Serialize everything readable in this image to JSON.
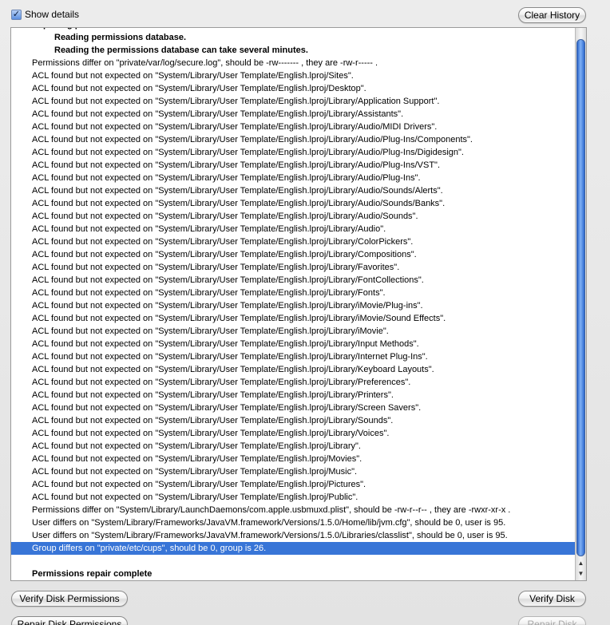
{
  "header": {
    "show_details_label": "Show details",
    "show_details_checked": "✓",
    "clear_history_label": "Clear History"
  },
  "log": {
    "lines": [
      {
        "text": "Repairing permissions for “Macintosh HD”",
        "style": "bold"
      },
      {
        "text": "Reading permissions database.",
        "style": "bold indent"
      },
      {
        "text": "Reading the permissions database can take several minutes.",
        "style": "bold indent"
      },
      {
        "text": "Permissions differ on \"private/var/log/secure.log\", should be -rw------- , they are -rw-r----- ."
      },
      {
        "text": "ACL found but not expected on \"System/Library/User Template/English.lproj/Sites\"."
      },
      {
        "text": "ACL found but not expected on \"System/Library/User Template/English.lproj/Desktop\"."
      },
      {
        "text": "ACL found but not expected on \"System/Library/User Template/English.lproj/Library/Application Support\"."
      },
      {
        "text": "ACL found but not expected on \"System/Library/User Template/English.lproj/Library/Assistants\"."
      },
      {
        "text": "ACL found but not expected on \"System/Library/User Template/English.lproj/Library/Audio/MIDI Drivers\"."
      },
      {
        "text": "ACL found but not expected on \"System/Library/User Template/English.lproj/Library/Audio/Plug-Ins/Components\"."
      },
      {
        "text": "ACL found but not expected on \"System/Library/User Template/English.lproj/Library/Audio/Plug-Ins/Digidesign\"."
      },
      {
        "text": "ACL found but not expected on \"System/Library/User Template/English.lproj/Library/Audio/Plug-Ins/VST\"."
      },
      {
        "text": "ACL found but not expected on \"System/Library/User Template/English.lproj/Library/Audio/Plug-Ins\"."
      },
      {
        "text": "ACL found but not expected on \"System/Library/User Template/English.lproj/Library/Audio/Sounds/Alerts\"."
      },
      {
        "text": "ACL found but not expected on \"System/Library/User Template/English.lproj/Library/Audio/Sounds/Banks\"."
      },
      {
        "text": "ACL found but not expected on \"System/Library/User Template/English.lproj/Library/Audio/Sounds\"."
      },
      {
        "text": "ACL found but not expected on \"System/Library/User Template/English.lproj/Library/Audio\"."
      },
      {
        "text": "ACL found but not expected on \"System/Library/User Template/English.lproj/Library/ColorPickers\"."
      },
      {
        "text": "ACL found but not expected on \"System/Library/User Template/English.lproj/Library/Compositions\"."
      },
      {
        "text": "ACL found but not expected on \"System/Library/User Template/English.lproj/Library/Favorites\"."
      },
      {
        "text": "ACL found but not expected on \"System/Library/User Template/English.lproj/Library/FontCollections\"."
      },
      {
        "text": "ACL found but not expected on \"System/Library/User Template/English.lproj/Library/Fonts\"."
      },
      {
        "text": "ACL found but not expected on \"System/Library/User Template/English.lproj/Library/iMovie/Plug-ins\"."
      },
      {
        "text": "ACL found but not expected on \"System/Library/User Template/English.lproj/Library/iMovie/Sound Effects\"."
      },
      {
        "text": "ACL found but not expected on \"System/Library/User Template/English.lproj/Library/iMovie\"."
      },
      {
        "text": "ACL found but not expected on \"System/Library/User Template/English.lproj/Library/Input Methods\"."
      },
      {
        "text": "ACL found but not expected on \"System/Library/User Template/English.lproj/Library/Internet Plug-Ins\"."
      },
      {
        "text": "ACL found but not expected on \"System/Library/User Template/English.lproj/Library/Keyboard Layouts\"."
      },
      {
        "text": "ACL found but not expected on \"System/Library/User Template/English.lproj/Library/Preferences\"."
      },
      {
        "text": "ACL found but not expected on \"System/Library/User Template/English.lproj/Library/Printers\"."
      },
      {
        "text": "ACL found but not expected on \"System/Library/User Template/English.lproj/Library/Screen Savers\"."
      },
      {
        "text": "ACL found but not expected on \"System/Library/User Template/English.lproj/Library/Sounds\"."
      },
      {
        "text": "ACL found but not expected on \"System/Library/User Template/English.lproj/Library/Voices\"."
      },
      {
        "text": "ACL found but not expected on \"System/Library/User Template/English.lproj/Library\"."
      },
      {
        "text": "ACL found but not expected on \"System/Library/User Template/English.lproj/Movies\"."
      },
      {
        "text": "ACL found but not expected on \"System/Library/User Template/English.lproj/Music\"."
      },
      {
        "text": "ACL found but not expected on \"System/Library/User Template/English.lproj/Pictures\"."
      },
      {
        "text": "ACL found but not expected on \"System/Library/User Template/English.lproj/Public\"."
      },
      {
        "text": "Permissions differ on \"System/Library/LaunchDaemons/com.apple.usbmuxd.plist\", should be -rw-r--r-- , they are -rwxr-xr-x ."
      },
      {
        "text": "User differs on \"System/Library/Frameworks/JavaVM.framework/Versions/1.5.0/Home/lib/jvm.cfg\", should be 0, user is 95."
      },
      {
        "text": "User differs on \"System/Library/Frameworks/JavaVM.framework/Versions/1.5.0/Libraries/classlist\", should be 0, user is 95."
      },
      {
        "text": "Group differs on \"private/etc/cups\", should be 0, group is 26.",
        "style": "selected"
      },
      {
        "text": "",
        "style": "blank"
      },
      {
        "text": "Permissions repair complete",
        "style": "bold"
      }
    ]
  },
  "footer": {
    "verify_permissions_label": "Verify Disk Permissions",
    "verify_disk_label": "Verify Disk",
    "repair_permissions_label": "Repair Disk Permissions",
    "repair_disk_label": "Repair Disk"
  },
  "colors": {
    "selection": "#3875d7",
    "scroll_thumb": "#4a86e8"
  }
}
